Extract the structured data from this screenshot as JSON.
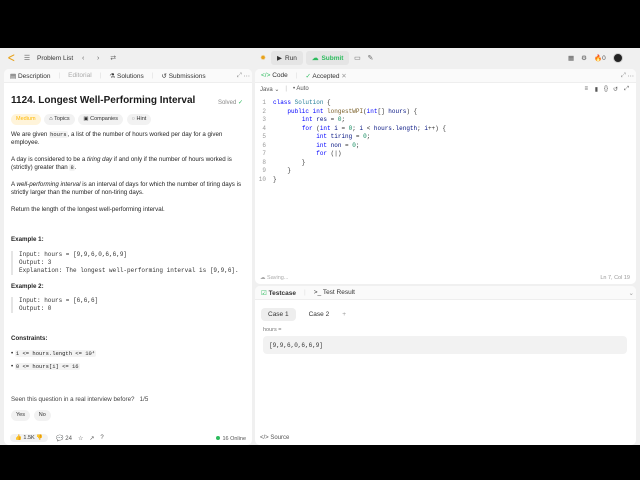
{
  "topbar": {
    "problem_list": "Problem List",
    "run": "Run",
    "submit": "Submit",
    "streak": "0"
  },
  "left_tabs": {
    "description": "Description",
    "editorial": "Editorial",
    "solutions": "Solutions",
    "submissions": "Submissions"
  },
  "problem": {
    "title": "1124. Longest Well-Performing Interval",
    "solved": "Solved",
    "difficulty": "Medium",
    "topics": "Topics",
    "companies": "Companies",
    "hint": "Hint",
    "p1a": "We are given ",
    "p1code": "hours",
    "p1b": ", a list of the number of hours worked per day for a given employee.",
    "p2a": "A day is considered to be a ",
    "p2em": "tiring day",
    "p2b": " if and only if the number of hours worked is (strictly) greater than ",
    "p2code": "8",
    "p2c": ".",
    "p3a": "A ",
    "p3em": "well-performing interval",
    "p3b": " is an interval of days for which the number of tiring days is strictly larger than the number of non-tiring days.",
    "p4": "Return the length of the longest well-performing interval.",
    "ex1_title": "Example 1:",
    "ex1_input": "Input: hours = [9,9,6,0,6,6,9]",
    "ex1_output": "Output: 3",
    "ex1_expl": "Explanation: The longest well-performing interval is [9,9,6].",
    "ex2_title": "Example 2:",
    "ex2_input": "Input: hours = [6,6,6]",
    "ex2_output": "Output: 0",
    "constraints": "Constraints:",
    "c1": "1 <= hours.length <= 10⁴",
    "c2": "0 <= hours[i] <= 16",
    "interview_q": "Seen this question in a real interview before?",
    "interview_count": "1/5",
    "yes": "Yes",
    "no": "No",
    "likes": "1.5K",
    "comments": "24",
    "online": "16 Online"
  },
  "code_tabs": {
    "code": "Code",
    "accepted": "Accepted"
  },
  "editor": {
    "language": "Java",
    "auto": "Auto",
    "lines": [
      "class Solution {",
      "    public int longestWPI(int[] hours) {",
      "        int res = 0;",
      "        for (int i = 0; i < hours.length; i++) {",
      "            int tiring = 0;",
      "            int non = 0;",
      "            for (|)",
      "        }",
      "    }",
      "}"
    ],
    "status": "Saving...",
    "cursor": "Ln 7, Col 19"
  },
  "testcase": {
    "tab_testcase": "Testcase",
    "tab_result": "Test Result",
    "case1": "Case 1",
    "case2": "Case 2",
    "var": "hours =",
    "value": "[9,9,6,0,6,6,9]",
    "source": "Source"
  }
}
